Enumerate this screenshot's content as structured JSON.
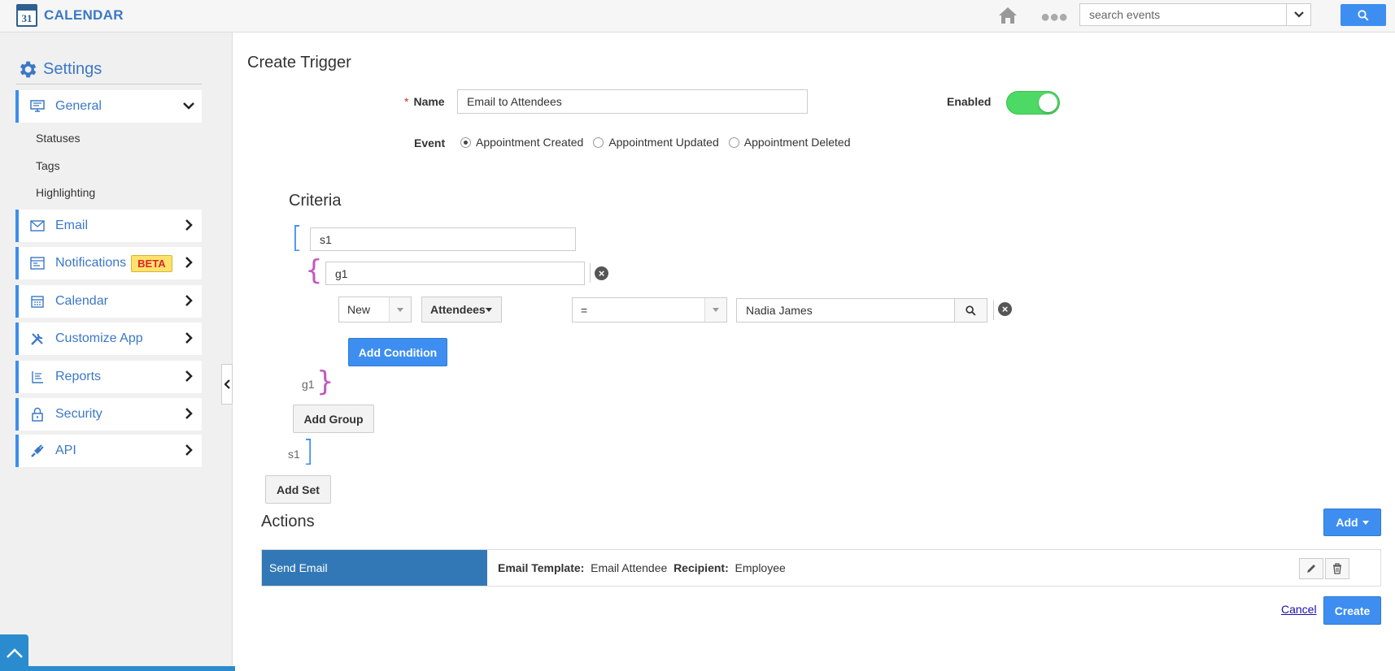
{
  "app": {
    "title": "CALENDAR",
    "logo_day": "31"
  },
  "topbar": {
    "search_placeholder": "search events"
  },
  "sidebar": {
    "heading": "Settings",
    "general": {
      "label": "General",
      "subitems": [
        "Statuses",
        "Tags",
        "Highlighting"
      ]
    },
    "items": [
      {
        "label": "Email"
      },
      {
        "label": "Notifications",
        "badge": "BETA"
      },
      {
        "label": "Calendar"
      },
      {
        "label": "Customize App"
      },
      {
        "label": "Reports"
      },
      {
        "label": "Security"
      },
      {
        "label": "API"
      }
    ]
  },
  "form": {
    "title": "Create Trigger",
    "name_label": "Name",
    "name_value": "Email to Attendees",
    "enabled_label": "Enabled",
    "enabled": true,
    "event_label": "Event",
    "events": [
      "Appointment Created",
      "Appointment Updated",
      "Appointment Deleted"
    ],
    "selected_event": "Appointment Created"
  },
  "criteria": {
    "title": "Criteria",
    "set_name": "s1",
    "group_name": "g1",
    "condition": {
      "type": "New",
      "field": "Attendees",
      "operator": "=",
      "value": "Nadia James"
    },
    "add_condition": "Add Condition",
    "group_close_label": "g1",
    "add_group": "Add Group",
    "set_close_label": "s1",
    "add_set": "Add Set"
  },
  "actions": {
    "title": "Actions",
    "add_button": "Add",
    "rows": [
      {
        "name": "Send Email",
        "template_label": "Email Template:",
        "template_value": "Email Attendee",
        "recipient_label": "Recipient:",
        "recipient_value": "Employee"
      }
    ]
  },
  "footer": {
    "cancel": "Cancel",
    "create": "Create"
  },
  "colors": {
    "accent": "#3d8ef0",
    "brand": "#3b78c6",
    "toggle_on": "#4cd964",
    "action_bg": "#3378b6",
    "brace": "#c159c1"
  }
}
